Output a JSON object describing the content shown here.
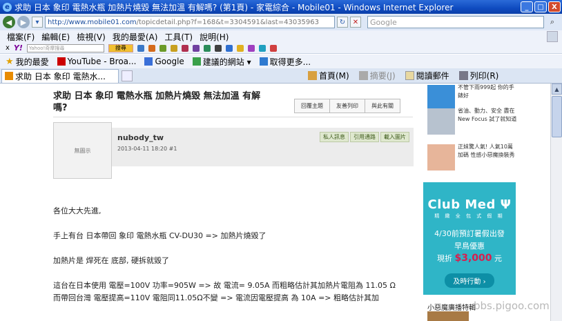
{
  "window": {
    "title": "求助 日本 象印 電熱水瓶 加熱片燒毀 無法加溫 有解嗎? (第1頁) - 家電綜合 - Mobile01 - Windows Internet Explorer",
    "minimize": "_",
    "maximize": "□",
    "close": "X"
  },
  "address": {
    "url_host": "http://www.mobile01.com",
    "url_path": "/topicdetail.php?f=168&t=3304591&last=43035963",
    "search_placeholder": "Google"
  },
  "menu": [
    "檔案(F)",
    "編輯(E)",
    "檢視(V)",
    "我的最愛(A)",
    "工具(T)",
    "說明(H)"
  ],
  "yahoo_toolbar": {
    "logo": "Y!",
    "search_placeholder": "Yahoo!奇摩搜尋",
    "search_button": "搜尋"
  },
  "favorites": {
    "label": "我的最愛",
    "items": [
      "YouTube - Broa...",
      "Google",
      "建議的網站 ▾",
      "取得更多..."
    ]
  },
  "tab": {
    "label": "求助 日本 象印 電熱水..."
  },
  "commands": [
    "首頁(M)",
    "摘要(J)",
    "閱讀郵件",
    "列印(R)"
  ],
  "post": {
    "title": "求助 日本 象印 電熱水瓶 加熱片燒毀 無法加溫 有解嗎?",
    "actions": [
      "回覆主題",
      "友善列印",
      "與此有關"
    ],
    "avatar_text": "無圖示",
    "author": "nubody_tw",
    "meta": "2013-04-11 18:20  #1",
    "author_buttons": [
      "私人訊息",
      "引用通路",
      "載入圖片"
    ],
    "paragraphs": [
      "各位大大先進,",
      "手上有台 日本帶回 象印 電熱水瓶 CV-DU30 => 加熱片燒毀了",
      "加熱片是 焊死在 底部, 硬拆就毀了",
      "這台在日本使用 電壓=100V 功率=905W => 故 電流= 9.05A 而粗略估計其加熱片電阻為 11.05 Ω",
      "而帶回台灣 電壓提高=110V 電阻同11.05Ω不變 => 電流因電壓提高 為 10A => 粗略估計其加"
    ]
  },
  "sidebar": {
    "ads": [
      "不管下雨999起 你的手錶好",
      "省油、動力、安全 盡在New Focus 試了就知道",
      "正妹驚人氣! 人氣10萬加碼 性感小惡魔換裝秀"
    ],
    "clubmed": {
      "logo": "Club Med Ψ",
      "subtitle": "精 緻 全 包 式 假 期",
      "line1": "4/30前預訂暑假出發",
      "line2": "早鳥優惠",
      "line3_prefix": "現折",
      "line3_amount": "$3,000",
      "line3_suffix": "元",
      "button": "及時行動 ›"
    },
    "heading": "小惡魔廣播特輯"
  },
  "watermark": "bbs.pigoo.com",
  "colors": {
    "titlebar": "#0f4bc0",
    "clubmed_bg": "#2fb5c7",
    "clubmed_price": "#d91e4e"
  }
}
